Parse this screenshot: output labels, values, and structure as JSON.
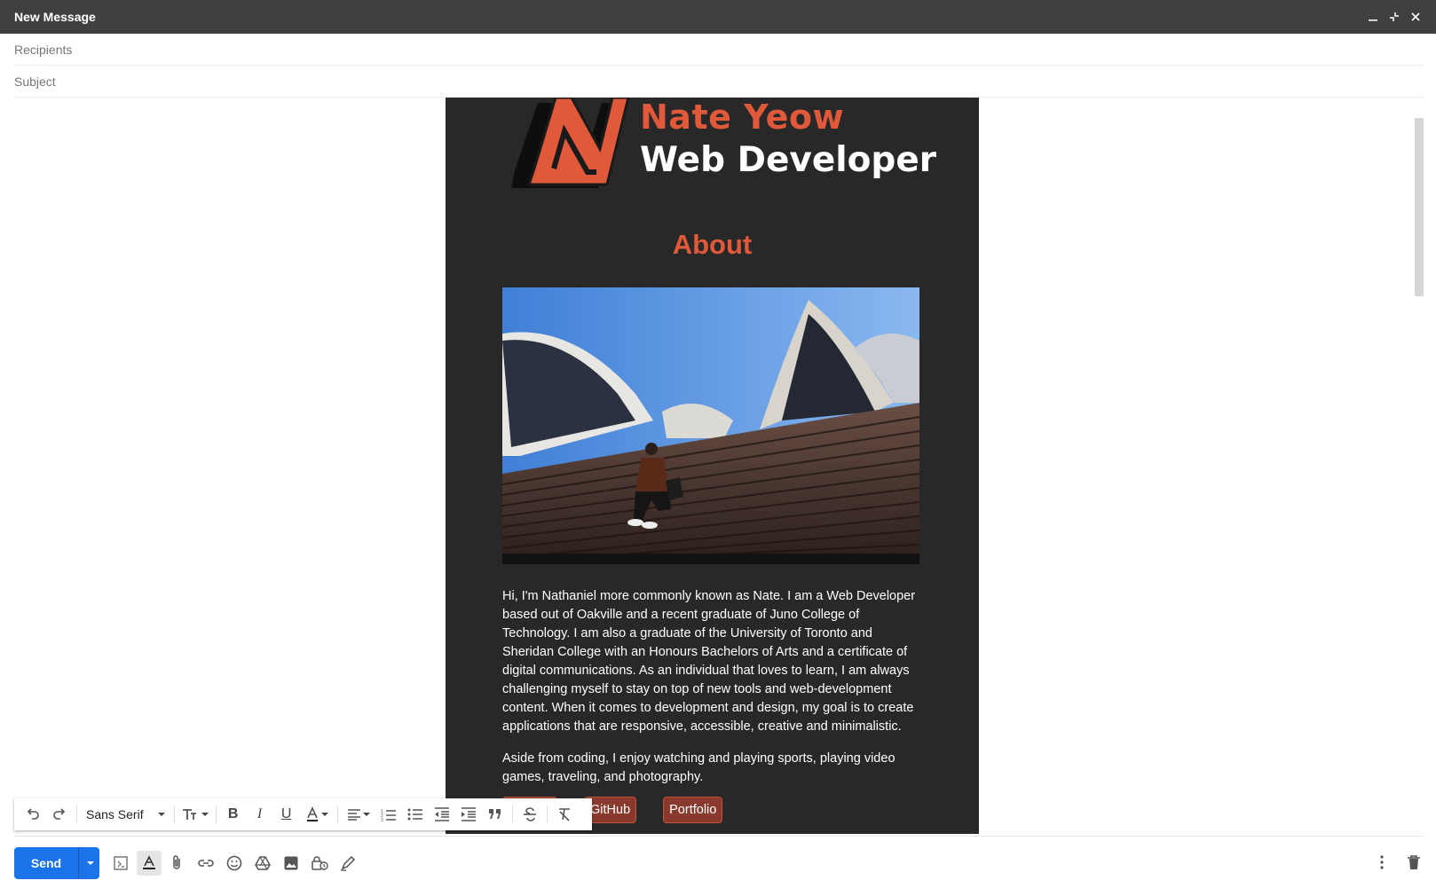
{
  "window": {
    "title": "New Message",
    "controls": [
      "minimize-icon",
      "exit-fullscreen-icon",
      "close-icon"
    ]
  },
  "fields": {
    "recipients_placeholder": "Recipients",
    "subject_placeholder": "Subject"
  },
  "newsletter": {
    "logo_name": "Nate Yeow",
    "logo_role": "Web Developer",
    "heading": "About",
    "bio_paragraphs": [
      "Hi, I'm Nathaniel more commonly known as Nate. I am a Web Developer based out of Oakville and a recent graduate of Juno College of Technology. I am also a graduate of the University of Toronto and Sheridan College with an Honours Bachelors of Arts and a certificate of digital communications. As an individual that loves to learn, I am always challenging myself to stay on top of new tools and web-development content. When it comes to development and design, my goal is to create applications that are responsive, accessible, creative and minimalistic.",
      "Aside from coding, I enjoy watching and playing sports, playing video games, traveling, and photography."
    ],
    "links": [
      "",
      "GitHub",
      "Portfolio"
    ],
    "colors": {
      "background": "#282828",
      "accent": "#e0593a",
      "button": "#8a3a2d"
    }
  },
  "format_toolbar": {
    "font": "Sans Serif",
    "tools": [
      "undo-icon",
      "redo-icon",
      "font-size-icon",
      "bold-icon",
      "italic-icon",
      "underline-icon",
      "text-color-icon",
      "align-icon",
      "numbered-list-icon",
      "bulleted-list-icon",
      "indent-less-icon",
      "indent-more-icon",
      "quote-icon",
      "strikethrough-icon",
      "remove-formatting-icon"
    ]
  },
  "bottom_bar": {
    "send_label": "Send",
    "send_color": "#1a73e8",
    "tools": [
      "formatting-options-icon",
      "text-format-icon",
      "attach-icon",
      "link-icon",
      "emoji-icon",
      "drive-icon",
      "photo-icon",
      "confidential-mode-icon",
      "signature-icon"
    ],
    "right_tools": [
      "more-options-icon",
      "discard-draft-icon"
    ]
  }
}
